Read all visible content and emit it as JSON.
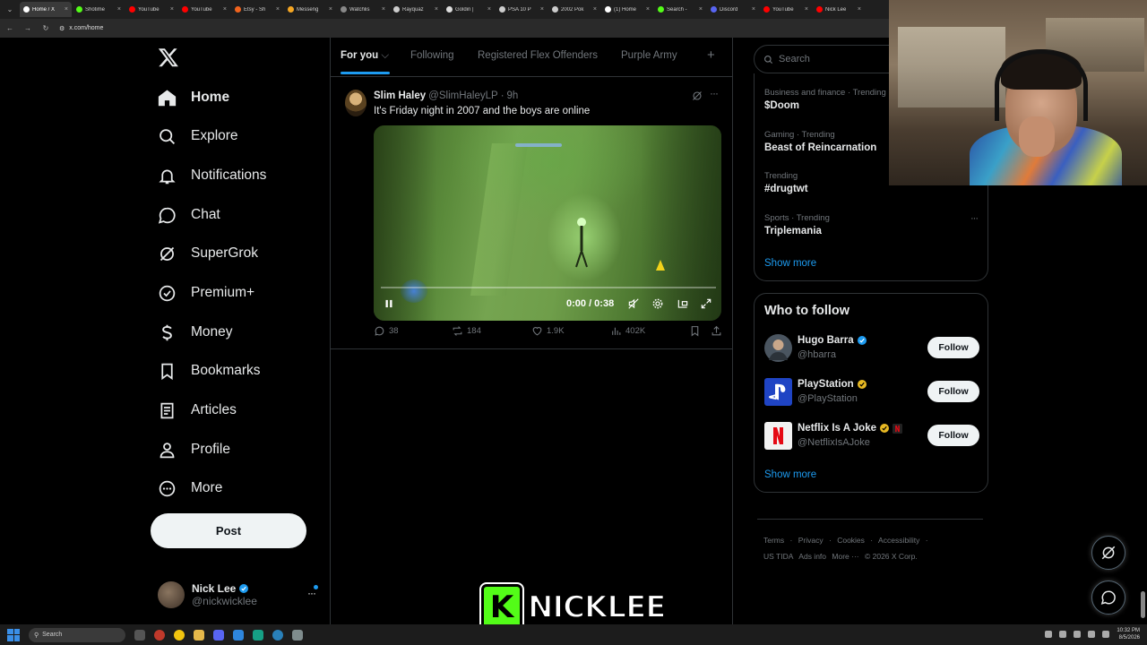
{
  "browser": {
    "tabs": [
      {
        "title": "Home / X",
        "color": "#ffffff",
        "active": true
      },
      {
        "title": "Shotime",
        "color": "#53fc18"
      },
      {
        "title": "YouTube",
        "color": "#ff0000"
      },
      {
        "title": "YouTube",
        "color": "#ff0000"
      },
      {
        "title": "Etsy - Sh",
        "color": "#f1641e"
      },
      {
        "title": "Messeng",
        "color": "#f5a623"
      },
      {
        "title": "Watchlis",
        "color": "#888888"
      },
      {
        "title": "Rayquaz",
        "color": "#cccccc"
      },
      {
        "title": "Goldin |",
        "color": "#dddddd"
      },
      {
        "title": "PSA 10 P",
        "color": "#cccccc"
      },
      {
        "title": "2002 Pok",
        "color": "#cccccc"
      },
      {
        "title": "(1) Home",
        "color": "#ffffff"
      },
      {
        "title": "Search -",
        "color": "#53fc18"
      },
      {
        "title": "Discord",
        "color": "#5865f2"
      },
      {
        "title": "YouTube",
        "color": "#ff0000"
      },
      {
        "title": "Nick Lee",
        "color": "#ff0000"
      }
    ],
    "url": "x.com/home"
  },
  "nav": {
    "items": [
      {
        "label": "Home",
        "icon": "home-icon"
      },
      {
        "label": "Explore",
        "icon": "search-icon"
      },
      {
        "label": "Notifications",
        "icon": "bell-icon"
      },
      {
        "label": "Chat",
        "icon": "chat-bubble-icon"
      },
      {
        "label": "SuperGrok",
        "icon": "grok-icon"
      },
      {
        "label": "Premium+",
        "icon": "verified-badge-icon"
      },
      {
        "label": "Money",
        "icon": "money-icon"
      },
      {
        "label": "Bookmarks",
        "icon": "bookmark-icon"
      },
      {
        "label": "Articles",
        "icon": "article-icon"
      },
      {
        "label": "Profile",
        "icon": "person-icon"
      },
      {
        "label": "More",
        "icon": "more-circle-icon"
      }
    ],
    "post_label": "Post",
    "account": {
      "name": "Nick Lee",
      "handle": "@nickwicklee"
    }
  },
  "timeline": {
    "tabs": [
      "For you",
      "Following",
      "Registered Flex Offenders",
      "Purple Army"
    ],
    "tweet": {
      "name": "Slim Haley",
      "handle": "@SlimHaleyLP",
      "separator": "·",
      "time": "9h",
      "text": "It's Friday night in 2007 and the boys are online",
      "video_time": "0:00 / 0:38",
      "video_progress": 0,
      "replies": "38",
      "reposts": "184",
      "likes": "1.9K",
      "views": "402K"
    }
  },
  "right": {
    "search_placeholder": "Search",
    "trends": [
      {
        "context": "Business and finance · Trending",
        "name": "$Doom"
      },
      {
        "context": "Gaming · Trending",
        "name": "Beast of Reincarnation"
      },
      {
        "context": "Trending",
        "name": "#drugtwt"
      },
      {
        "context": "Sports · Trending",
        "name": "Triplemania"
      }
    ],
    "show_more": "Show more",
    "who_to_follow": {
      "title": "Who to follow",
      "accounts": [
        {
          "name": "Hugo Barra",
          "handle": "@hbarra",
          "badge": "#1d9bf0"
        },
        {
          "name": "PlayStation",
          "handle": "@PlayStation",
          "badge": "#e8b923"
        },
        {
          "name": "Netflix Is A Joke",
          "handle": "@NetflixIsAJoke",
          "badge": "#e8b923"
        }
      ],
      "follow_label": "Follow",
      "show_more": "Show more"
    },
    "footer": [
      "Terms",
      "Privacy",
      "Cookies",
      "Accessibility",
      "US TIDA",
      "Ads info",
      "More ···",
      "© 2026 X Corp."
    ]
  },
  "banner": {
    "logo_letter": "K",
    "text": "NICKLEE"
  },
  "taskbar": {
    "search": "Search",
    "time": "10:32 PM",
    "date": "8/5/2026"
  },
  "colors": {
    "accent": "#1d9bf0",
    "background": "#000000",
    "text": "#e7e9ea",
    "muted": "#71767b",
    "kick_green": "#53fc18"
  }
}
